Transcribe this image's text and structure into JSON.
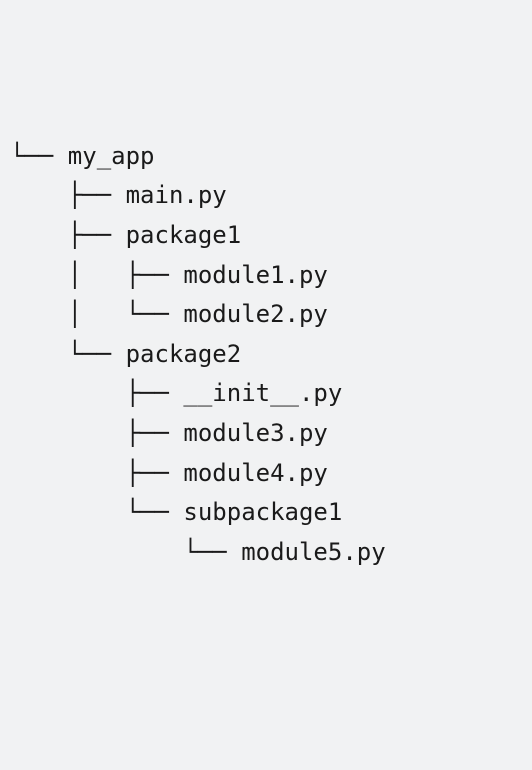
{
  "tree": {
    "lines": [
      "└── my_app",
      "    ├── main.py",
      "    ├── package1",
      "    │   ├── module1.py",
      "    │   └── module2.py",
      "    └── package2",
      "        ├── __init__.py",
      "        ├── module3.py",
      "        ├── module4.py",
      "        └── subpackage1",
      "            └── module5.py"
    ]
  }
}
